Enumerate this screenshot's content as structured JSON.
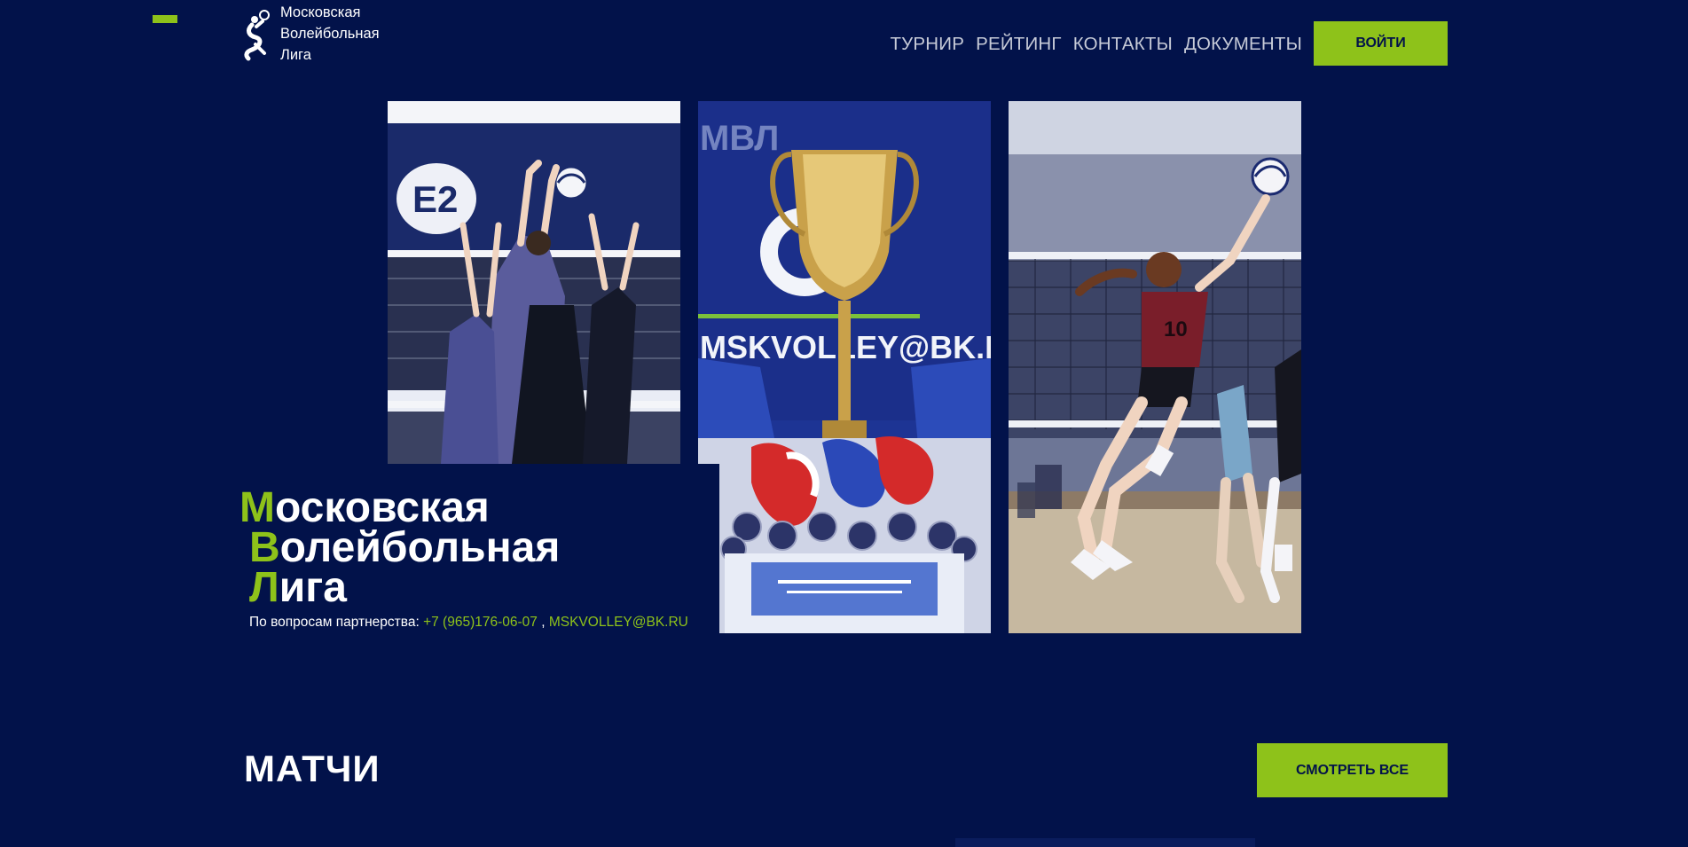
{
  "header": {
    "logo_lines": [
      "Московская",
      "Волейбольная",
      "Лига"
    ],
    "menu_icon": "menu-icon",
    "logo_icon": "volleyball-player-icon",
    "nav": [
      "ТУРНИР",
      "РЕЙТИНГ",
      "КОНТАКТЫ",
      "ДОКУМЕНТЫ"
    ],
    "login_label": "ВОЙТИ"
  },
  "hero": {
    "title_lines": [
      {
        "accent": "М",
        "rest": "осковская"
      },
      {
        "accent": "В",
        "rest": "олейбольная"
      },
      {
        "accent": "Л",
        "rest": "ига"
      }
    ],
    "partners_label": "По вопросам партнерства:",
    "phone": "+7 (965)176-06-07",
    "separator": ",",
    "email": "MSKVOLLEY@BK.RU",
    "photos": [
      {
        "name": "volleyball-block-photo",
        "banner_text": "E2"
      },
      {
        "name": "trophy-and-medals-photo",
        "banner_text": "MSKVOLLEY@BK.RU",
        "banner_text_2": "МВЛ"
      },
      {
        "name": "volleyball-spike-photo",
        "jersey_number": "10"
      }
    ]
  },
  "matches": {
    "title": "МАТЧИ",
    "see_all_label": "СМОТРЕТЬ ВСЕ"
  },
  "colors": {
    "background": "#02124a",
    "accent": "#8ec21a",
    "nav_text": "#c7cbd8"
  }
}
